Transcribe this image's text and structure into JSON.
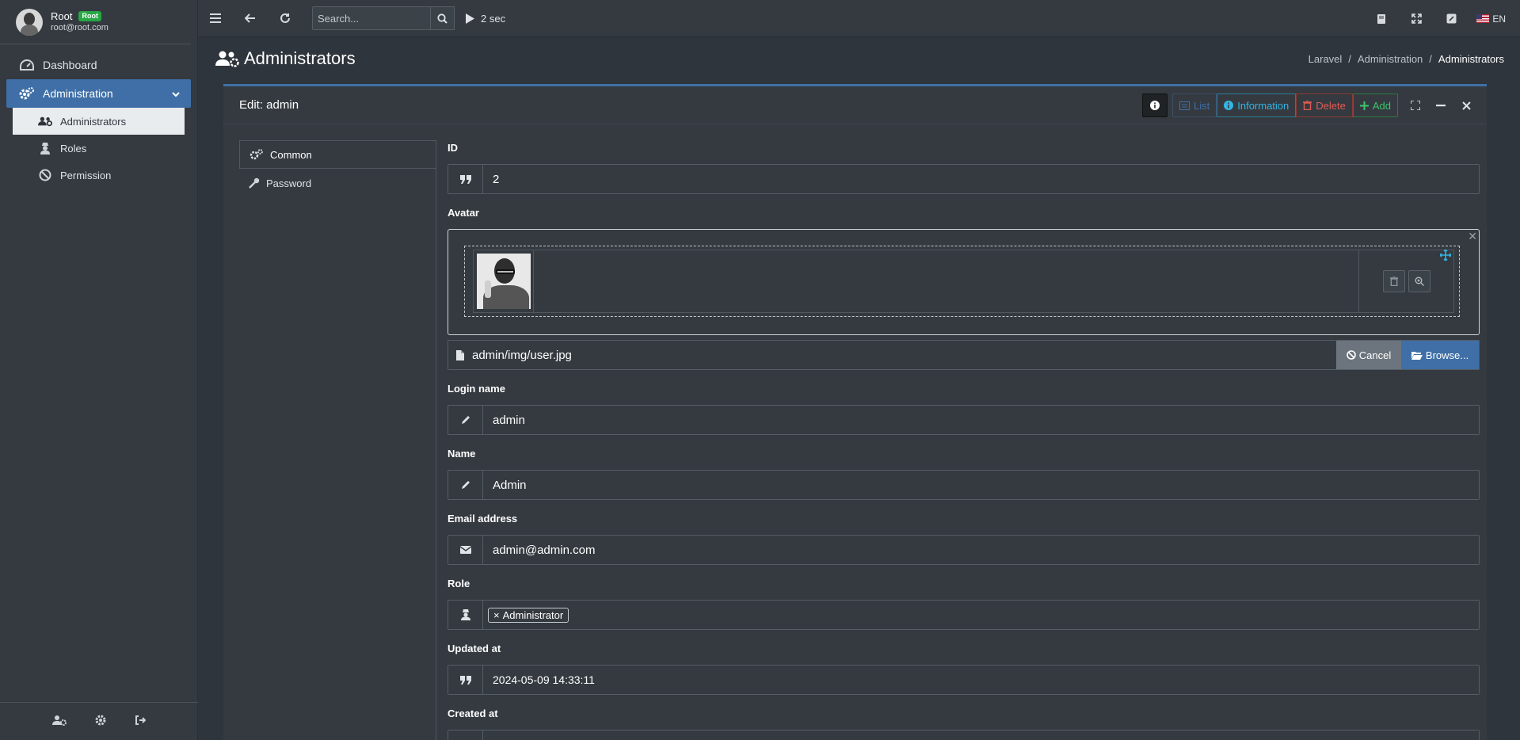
{
  "user": {
    "name": "Root",
    "badge": "Root",
    "email": "root@root.com"
  },
  "sidebar": {
    "items": [
      {
        "label": "Dashboard"
      },
      {
        "label": "Administration"
      }
    ],
    "subitems": [
      {
        "label": "Administrators"
      },
      {
        "label": "Roles"
      },
      {
        "label": "Permission"
      }
    ]
  },
  "navbar": {
    "search_placeholder": "Search...",
    "timer": "2 sec",
    "language": "EN"
  },
  "header": {
    "title": "Administrators",
    "breadcrumb": [
      "Laravel",
      "/",
      "Administration",
      "/",
      "Administrators"
    ]
  },
  "card": {
    "title": "Edit: admin",
    "tools": {
      "list": "List",
      "information": "Information",
      "delete": "Delete",
      "add": "Add"
    }
  },
  "tabs": [
    {
      "label": "Common"
    },
    {
      "label": "Password"
    }
  ],
  "form": {
    "id_label": "ID",
    "id_value": "2",
    "avatar_label": "Avatar",
    "avatar_file": "admin/img/user.jpg",
    "cancel_label": "Cancel",
    "browse_label": "Browse...",
    "login_label": "Login name",
    "login_value": "admin",
    "name_label": "Name",
    "name_value": "Admin",
    "email_label": "Email address",
    "email_value": "admin@admin.com",
    "role_label": "Role",
    "role_tag": "Administrator",
    "updated_label": "Updated at",
    "updated_value": "2024-05-09 14:33:11",
    "created_label": "Created at"
  },
  "colors": {
    "accent": "#3f6fa6",
    "info": "#33b5e5",
    "danger": "#e25b55",
    "success": "#3ec46d",
    "background": "#2f353c"
  }
}
